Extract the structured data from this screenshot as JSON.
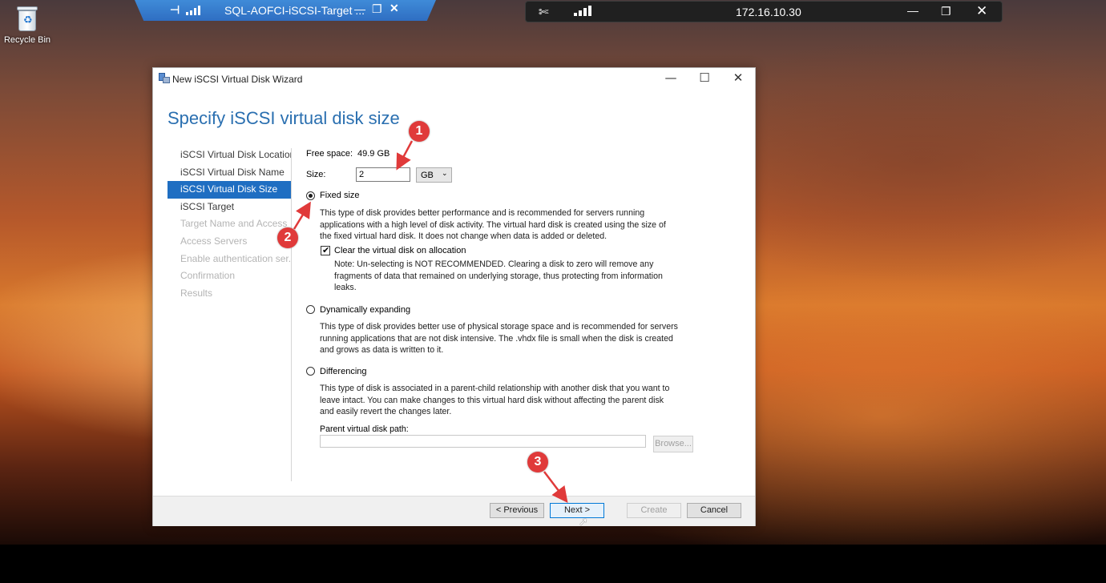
{
  "desktop": {
    "recycle_bin_label": "Recycle Bin"
  },
  "rdp_bar": {
    "title": "SQL-AOFCI-iSCSI-Target ...",
    "pin_glyph": "⊣",
    "minimize": "—",
    "restore": "❐",
    "close": "✕"
  },
  "connection_bar": {
    "ip": "172.16.10.30",
    "pin_glyph": "✕",
    "minimize": "—",
    "restore": "❐",
    "close": "✕"
  },
  "window": {
    "title": "New iSCSI Virtual Disk Wizard",
    "minimize": "—",
    "maximize": "☐",
    "close": "✕",
    "heading": "Specify iSCSI virtual disk size"
  },
  "nav": {
    "items": [
      {
        "label": "iSCSI Virtual Disk Location",
        "state": "normal"
      },
      {
        "label": "iSCSI Virtual Disk Name",
        "state": "normal"
      },
      {
        "label": "iSCSI Virtual Disk Size",
        "state": "active"
      },
      {
        "label": "iSCSI Target",
        "state": "normal"
      },
      {
        "label": "Target Name and Access",
        "state": "disabled"
      },
      {
        "label": "Access Servers",
        "state": "disabled"
      },
      {
        "label": "Enable authentication ser...",
        "state": "disabled"
      },
      {
        "label": "Confirmation",
        "state": "disabled"
      },
      {
        "label": "Results",
        "state": "disabled"
      }
    ]
  },
  "form": {
    "free_space_label": "Free space:",
    "free_space_value": "49.9 GB",
    "size_label": "Size:",
    "size_value": "2",
    "unit_value": "GB",
    "fixed": {
      "label": "Fixed size",
      "selected": true,
      "desc_1": "This type of disk provides better performance and is recommended for servers running",
      "desc_2": "applications with a high level of disk activity. The virtual hard disk is created using the size of",
      "desc_3": "the fixed virtual hard disk. It does not change when data is added or deleted.",
      "clear_label": "Clear the virtual disk on allocation",
      "clear_checked": true,
      "note_1": "Note: Un-selecting is NOT RECOMMENDED. Clearing a disk to zero will remove any",
      "note_2": "fragments of data that remained on underlying storage, thus protecting from information",
      "note_3": "leaks."
    },
    "dynamic": {
      "label": "Dynamically expanding",
      "selected": false,
      "desc_1": "This type of disk provides better use of physical storage space and is recommended for servers",
      "desc_2": "running applications that are not disk intensive. The .vhdx file is small when the disk is created",
      "desc_3": "and grows as data is written to it."
    },
    "differencing": {
      "label": "Differencing",
      "selected": false,
      "desc_1": "This type of disk is associated in a parent-child relationship with another disk that you want to",
      "desc_2": "leave intact. You can make changes to this virtual hard disk without affecting the parent disk",
      "desc_3": "and easily revert the changes later.",
      "parent_path_label": "Parent virtual disk path:",
      "parent_path_value": "",
      "browse_label": "Browse..."
    }
  },
  "footer": {
    "previous_label": "< Previous",
    "next_label": "Next >",
    "create_label": "Create",
    "cancel_label": "Cancel"
  },
  "annotations": {
    "marker_color": "#e03a3a",
    "markers": [
      "1",
      "2",
      "3"
    ]
  },
  "colors": {
    "accent": "#1f6ec2",
    "heading": "#2a6fb0"
  }
}
